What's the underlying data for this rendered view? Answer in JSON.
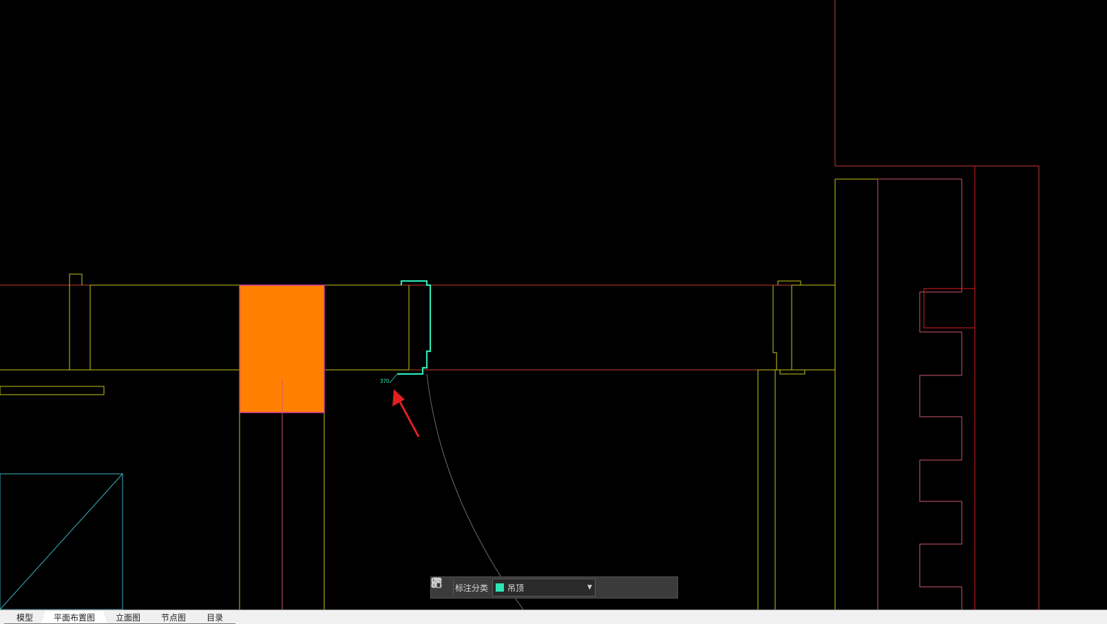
{
  "drawing": {
    "dimension_text": "370",
    "colors": {
      "background": "#000000",
      "wall_yellow": "#c8c81e",
      "line_red": "#c83c32",
      "bright_red": "#e01e1e",
      "pink_red": "#d25a6e",
      "highlight_cyan": "#2de6b4",
      "column_fill": "#ff8000",
      "column_border": "#d23ca0",
      "arc_gray": "#6e6e6e",
      "cyan_box": "#3cb4c8",
      "arrow_red": "#e02020"
    }
  },
  "toolbar": {
    "grid_icon": "grid-icon",
    "label": "标注分类",
    "layer_value": "吊顶",
    "layer_color": "#2de6b4",
    "icons": [
      "edit-icon",
      "move-icon",
      "copy-icon",
      "paste-icon"
    ]
  },
  "tabs": [
    {
      "label": "模型",
      "active": false
    },
    {
      "label": "平面布置图",
      "active": true
    },
    {
      "label": "立面图",
      "active": false
    },
    {
      "label": "节点图",
      "active": false
    },
    {
      "label": "目录",
      "active": false
    }
  ]
}
